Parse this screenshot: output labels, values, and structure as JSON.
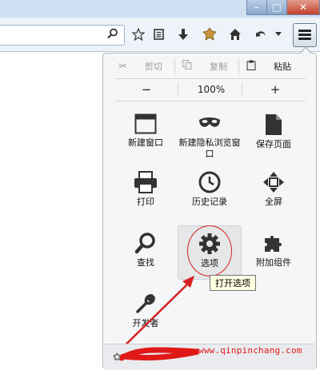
{
  "window": {
    "minimize_glyph": "–",
    "maximize_glyph": "□",
    "close_glyph": "✕"
  },
  "toolbar": {
    "search_icon": "search-icon",
    "icons": [
      "star-icon",
      "bookmarks-icon",
      "download-icon",
      "addon-icon",
      "home-icon",
      "back-icon",
      "chevron-down-icon",
      "hamburger-menu-icon"
    ]
  },
  "menu": {
    "edit": {
      "cut_label": "剪切",
      "copy_label": "复制",
      "paste_label": "粘贴"
    },
    "zoom": {
      "out_label": "−",
      "level": "100%",
      "in_label": "+"
    },
    "items": [
      {
        "label": "新建窗口",
        "icon": "new-window-icon"
      },
      {
        "label": "新建隐私浏览窗口",
        "icon": "private-mask-icon"
      },
      {
        "label": "保存页面",
        "icon": "save-page-icon"
      },
      {
        "label": "打印",
        "icon": "printer-icon"
      },
      {
        "label": "历史记录",
        "icon": "clock-icon"
      },
      {
        "label": "全屏",
        "icon": "fullscreen-arrows-icon"
      },
      {
        "label": "查找",
        "icon": "magnifier-icon"
      },
      {
        "label": "选项",
        "icon": "gear-icon"
      },
      {
        "label": "附加组件",
        "icon": "puzzle-icon"
      },
      {
        "label": "开发者",
        "icon": "wrench-icon"
      }
    ],
    "tooltip": "打开选项"
  },
  "annotation": {
    "watermark": "www.qinpinchang.com",
    "color": "#d42020"
  },
  "colors": {
    "panel_bg": "#f5f6f7",
    "accent_red": "#d42020"
  }
}
